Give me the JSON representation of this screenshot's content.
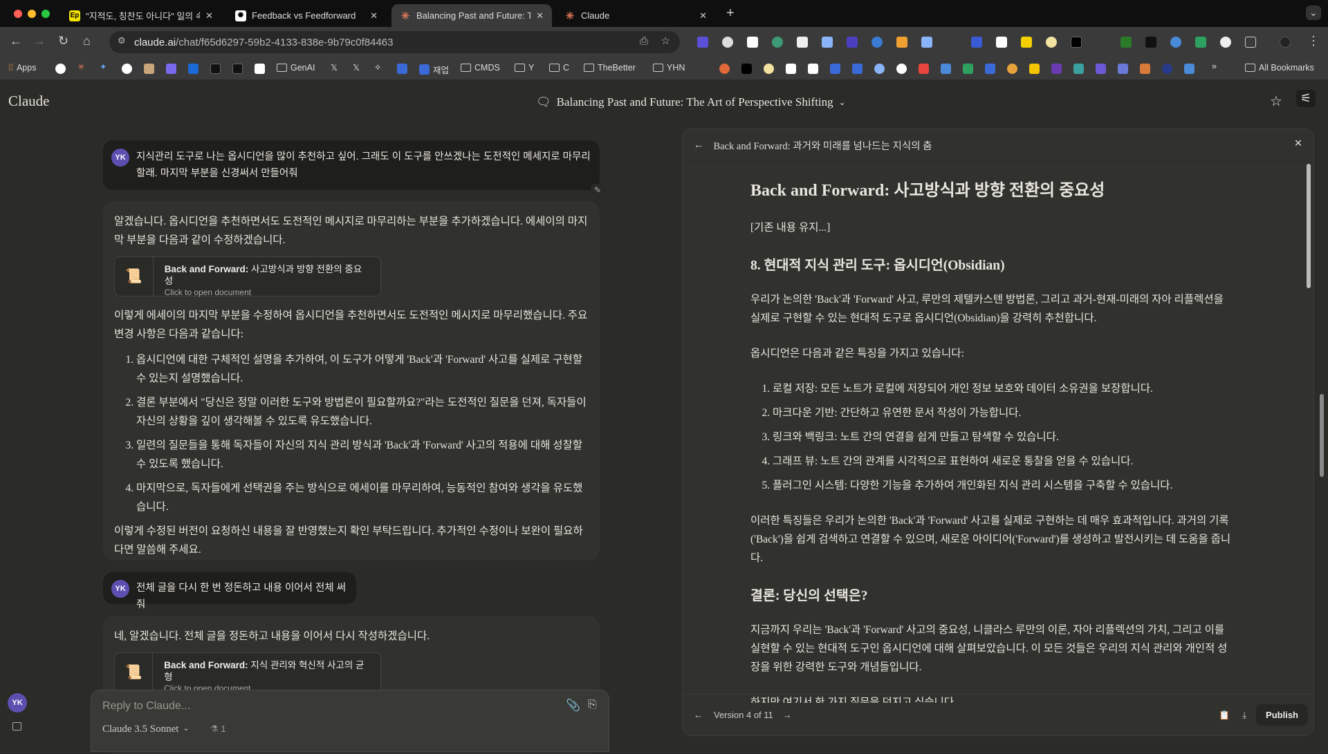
{
  "browser": {
    "tabs": [
      {
        "title": "\"지적도, 칭찬도 아니다\" 일의 속도",
        "favicon": "Ep",
        "favicon_color": "#f5e400"
      },
      {
        "title": "Feedback vs Feedforward",
        "favicon": "openai-icon",
        "favicon_color": "#ffffff"
      },
      {
        "title": "Balancing Past and Future: Th",
        "favicon": "claude-icon",
        "favicon_color": "#d97757",
        "active": true
      },
      {
        "title": "Claude",
        "favicon": "claude-icon",
        "favicon_color": "#d97757"
      }
    ],
    "url_host": "claude.ai",
    "url_path": "/chat/f65d6297-59b2-4133-838e-9b79c0f84463",
    "bookmarks": [
      "Apps",
      "GenAI",
      "재업",
      "CMDS",
      "Y",
      "C",
      "TheBetter",
      "YHN",
      "All Bookmarks"
    ]
  },
  "app": {
    "logo": "Claude",
    "conversation_title": "Balancing Past and Future: The Art of Perspective Shifting",
    "accent": "#d97757",
    "avatar_color": "#5b4fb0"
  },
  "chat": {
    "user_initials": "YK",
    "msg1": "지식관리 도구로 나는 옵시디언을 많이 추천하고 싶어. 그래도 이 도구를 안쓰겠나는 도전적인 메세지로 마무리할래. 마지막 부분을 신경써서 만들어줘",
    "reply1_intro": "알겠습니다. 옵시디언을 추천하면서도 도전적인 메시지로 마무리하는 부분을 추가하겠습니다. 에세이의 마지막 부분을 다음과 같이 수정하겠습니다.",
    "card1_bold": "Back and Forward:",
    "card1_rest": " 사고방식과 방향 전환의 중요성",
    "card_sub": "Click to open document",
    "reply1_mid": "이렇게 에세이의 마지막 부분을 수정하여 옵시디언을 추천하면서도 도전적인 메시지로 마무리했습니다. 주요 변경 사항은 다음과 같습니다:",
    "reply1_list": [
      "옵시디언에 대한 구체적인 설명을 추가하여, 이 도구가 어떻게 'Back'과 'Forward' 사고를 실제로 구현할 수 있는지 설명했습니다.",
      "결론 부분에서 \"당신은 정말 이러한 도구와 방법론이 필요할까요?\"라는 도전적인 질문을 던져, 독자들이 자신의 상황을 깊이 생각해볼 수 있도록 유도했습니다.",
      "일련의 질문들을 통해 독자들이 자신의 지식 관리 방식과 'Back'과 'Forward' 사고의 적용에 대해 성찰할 수 있도록 했습니다.",
      "마지막으로, 독자들에게 선택권을 주는 방식으로 에세이를 마무리하여, 능동적인 참여와 생각을 유도했습니다."
    ],
    "reply1_end": "이렇게 수정된 버전이 요청하신 내용을 잘 반영했는지 확인 부탁드립니다. 추가적인 수정이나 보완이 필요하다면 말씀해 주세요.",
    "msg2": "전체 글을 다시 한 번 정돈하고 내용 이어서 전체 써줘",
    "reply2_intro": "네, 알겠습니다. 전체 글을 정돈하고 내용을 이어서 다시 작성하겠습니다.",
    "card2_bold": "Back and Forward:",
    "card2_rest": " 지식 관리와 혁신적 사고의 균형",
    "input_placeholder": "Reply to Claude...",
    "model": "Claude 3.5 Sonnet",
    "count": "1"
  },
  "panel": {
    "header": "Back and Forward: 과거와 미래를 넘나드는 지식의 춤",
    "h1": "Back and Forward: 사고방식과 방향 전환의 중요성",
    "p0": "[기존 내용 유지...]",
    "h2a": "8. 현대적 지식 관리 도구: 옵시디언(Obsidian)",
    "p1": "우리가 논의한 'Back'과 'Forward' 사고, 루만의 제텔카스텐 방법론, 그리고 과거-현재-미래의 자아 리플렉션을 실제로 구현할 수 있는 현대적 도구로 옵시디언(Obsidian)을 강력히 추천합니다.",
    "p2": "옵시디언은 다음과 같은 특징을 가지고 있습니다:",
    "list": [
      "로컬 저장: 모든 노트가 로컬에 저장되어 개인 정보 보호와 데이터 소유권을 보장합니다.",
      "마크다운 기반: 간단하고 유연한 문서 작성이 가능합니다.",
      "링크와 백링크: 노트 간의 연결을 쉽게 만들고 탐색할 수 있습니다.",
      "그래프 뷰: 노트 간의 관계를 시각적으로 표현하여 새로운 통찰을 얻을 수 있습니다.",
      "플러그인 시스템: 다양한 기능을 추가하여 개인화된 지식 관리 시스템을 구축할 수 있습니다."
    ],
    "p3": "이러한 특징들은 우리가 논의한 'Back'과 'Forward' 사고를 실제로 구현하는 데 매우 효과적입니다. 과거의 기록('Back')을 쉽게 검색하고 연결할 수 있으며, 새로운 아이디어('Forward')를 생성하고 발전시키는 데 도움을 줍니다.",
    "h2b": "결론: 당신의 선택은?",
    "p4": "지금까지 우리는 'Back'과 'Forward' 사고의 중요성, 니클라스 루만의 이론, 자아 리플렉션의 가치, 그리고 이를 실현할 수 있는 현대적 도구인 옵시디언에 대해 살펴보았습니다. 이 모든 것들은 우리의 지식 관리와 개인적 성장을 위한 강력한 도구와 개념들입니다.",
    "p5": "하지만 여기서 한 가지 질문을 던지고 싶습니다.",
    "version": "Version 4 of 11",
    "publish": "Publish"
  }
}
